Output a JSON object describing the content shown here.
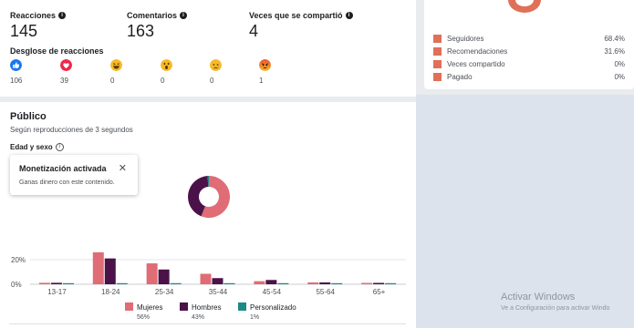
{
  "metrics": {
    "reactions_label": "Reacciones",
    "reactions_value": "145",
    "comments_label": "Comentarios",
    "comments_value": "163",
    "shares_label": "Veces que se compartió",
    "shares_value": "4"
  },
  "breakdown": {
    "title": "Desglose de reacciones",
    "items": [
      {
        "icon": "like-icon",
        "count": "106"
      },
      {
        "icon": "love-icon",
        "count": "39"
      },
      {
        "icon": "haha-icon",
        "count": "0"
      },
      {
        "icon": "wow-icon",
        "count": "0"
      },
      {
        "icon": "sad-icon",
        "count": "0"
      },
      {
        "icon": "angry-icon",
        "count": "1"
      }
    ]
  },
  "distribution": {
    "items": [
      {
        "label": "Seguidores",
        "pct": "68.4%"
      },
      {
        "label": "Recomendaciones",
        "pct": "31.6%"
      },
      {
        "label": "Veces compartido",
        "pct": "0%"
      },
      {
        "label": "Pagado",
        "pct": "0%"
      }
    ],
    "swatch_color": "#e07057"
  },
  "publico": {
    "title": "Público",
    "subtitle": "Según reproducciones de 3 segundos",
    "section": "Edad y sexo"
  },
  "tooltip": {
    "title": "Monetización activada",
    "close": "✕",
    "body": "Ganas dinero con este contenido."
  },
  "chart_data": {
    "type": "bar",
    "categories": [
      "13-17",
      "18-24",
      "25-34",
      "35-44",
      "45-54",
      "55-64",
      "65+"
    ],
    "series": [
      {
        "name": "Mujeres",
        "color": "#e06c75",
        "values": [
          1.2,
          26,
          17,
          8.5,
          2.5,
          1.5,
          1.0
        ]
      },
      {
        "name": "Hombres",
        "color": "#4a1248",
        "values": [
          1.2,
          21,
          12,
          5,
          3.5,
          1.5,
          0.5
        ]
      },
      {
        "name": "Personalizado",
        "color": "#1b8a86",
        "values": [
          0,
          0,
          0,
          0,
          0,
          0,
          0
        ]
      }
    ],
    "yticks": [
      "20%",
      "0%"
    ],
    "ylim": [
      0,
      30
    ],
    "legend": [
      {
        "name": "Mujeres",
        "pct": "56%"
      },
      {
        "name": "Hombres",
        "pct": "43%"
      },
      {
        "name": "Personalizado",
        "pct": "1%"
      }
    ],
    "donut": {
      "Mujeres": 56,
      "Hombres": 43,
      "Personalizado": 1
    }
  },
  "watermark": {
    "title": "Activar Windows",
    "body": "Ve a Configuración para activar Windo"
  }
}
